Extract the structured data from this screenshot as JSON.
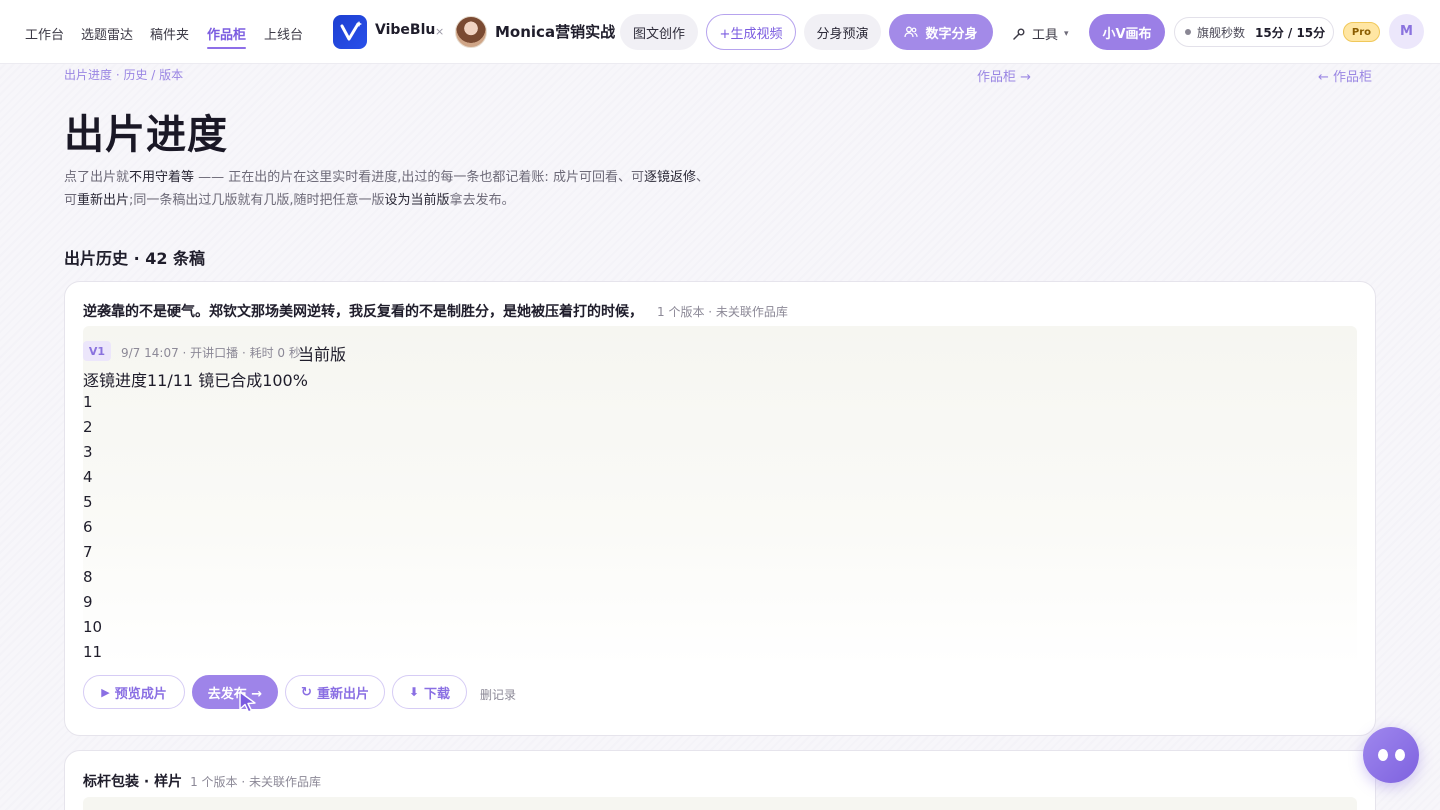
{
  "nav": {
    "links": [
      "工作台",
      "选题雷达",
      "稿件夹",
      "作品柜",
      "上线台"
    ],
    "active_index": 3,
    "logo_text": "VibeBlu",
    "separator": "×",
    "brand_name": "Monica营销实战",
    "pills": {
      "article": "图文创作",
      "generate_video": "+生成视频",
      "preview": "分身预演",
      "digital_avatar": "数字分身",
      "tools": "工具",
      "canvas": "小V画布"
    },
    "quota": {
      "label": "旗舰秒数",
      "value": "15分 / 15分"
    },
    "pro_badge": "Pro",
    "user_initial": "M"
  },
  "page": {
    "breadcrumb": "出片进度 · 历史 / 版本",
    "link_cabinet": "作品柜 →",
    "link_back": "← 作品柜",
    "title": "出片进度",
    "intro": {
      "p1": "点了出片就",
      "p2": "不用守着等",
      "p3": " —— 正在出的片在这里实时看进度,出过的每一条也都记着账: 成片可回看、可",
      "p4": "逐镜返修",
      "p5": "、可",
      "p6": "重新出片",
      "p7": ";同一条稿出过几版就有几版,随时把任意一版",
      "p8": "设为当前版",
      "p9": "拿去发布。"
    },
    "history_title": "出片历史 · 42 条稿"
  },
  "cards": [
    {
      "title": "逆袭靠的不是硬气。郑钦文那场美网逆转，我反复看的不是制胜分，是她被压着打的时候，",
      "meta": "1 个版本 · 未关联作品库",
      "version": {
        "tag": "V1",
        "meta": "9/7 14:07 · 开讲口播 · 耗时 0 秒",
        "current_label": "当前版",
        "progress": "逐镜进度11/11 镜已合成100%",
        "shots": [
          "1",
          "2",
          "3",
          "4",
          "5",
          "6",
          "7",
          "8",
          "9",
          "10",
          "11"
        ]
      },
      "actions": {
        "preview": "预览成片",
        "publish": "去发布 →",
        "regenerate": "重新出片",
        "download": "下载",
        "delete": "删记录"
      }
    },
    {
      "title": "标杆包装 · 样片",
      "meta": "1 个版本 · 未关联作品库"
    }
  ],
  "colors": {
    "accent": "#9e84e9",
    "accent_text": "#7b5ce0",
    "logo_blue": "#2950ea",
    "pro_yellow": "#ffe6a3"
  },
  "icons": [
    "play-icon",
    "refresh-icon",
    "download-icon",
    "wrench-icon",
    "users-icon",
    "robot-icon",
    "cursor-icon"
  ]
}
